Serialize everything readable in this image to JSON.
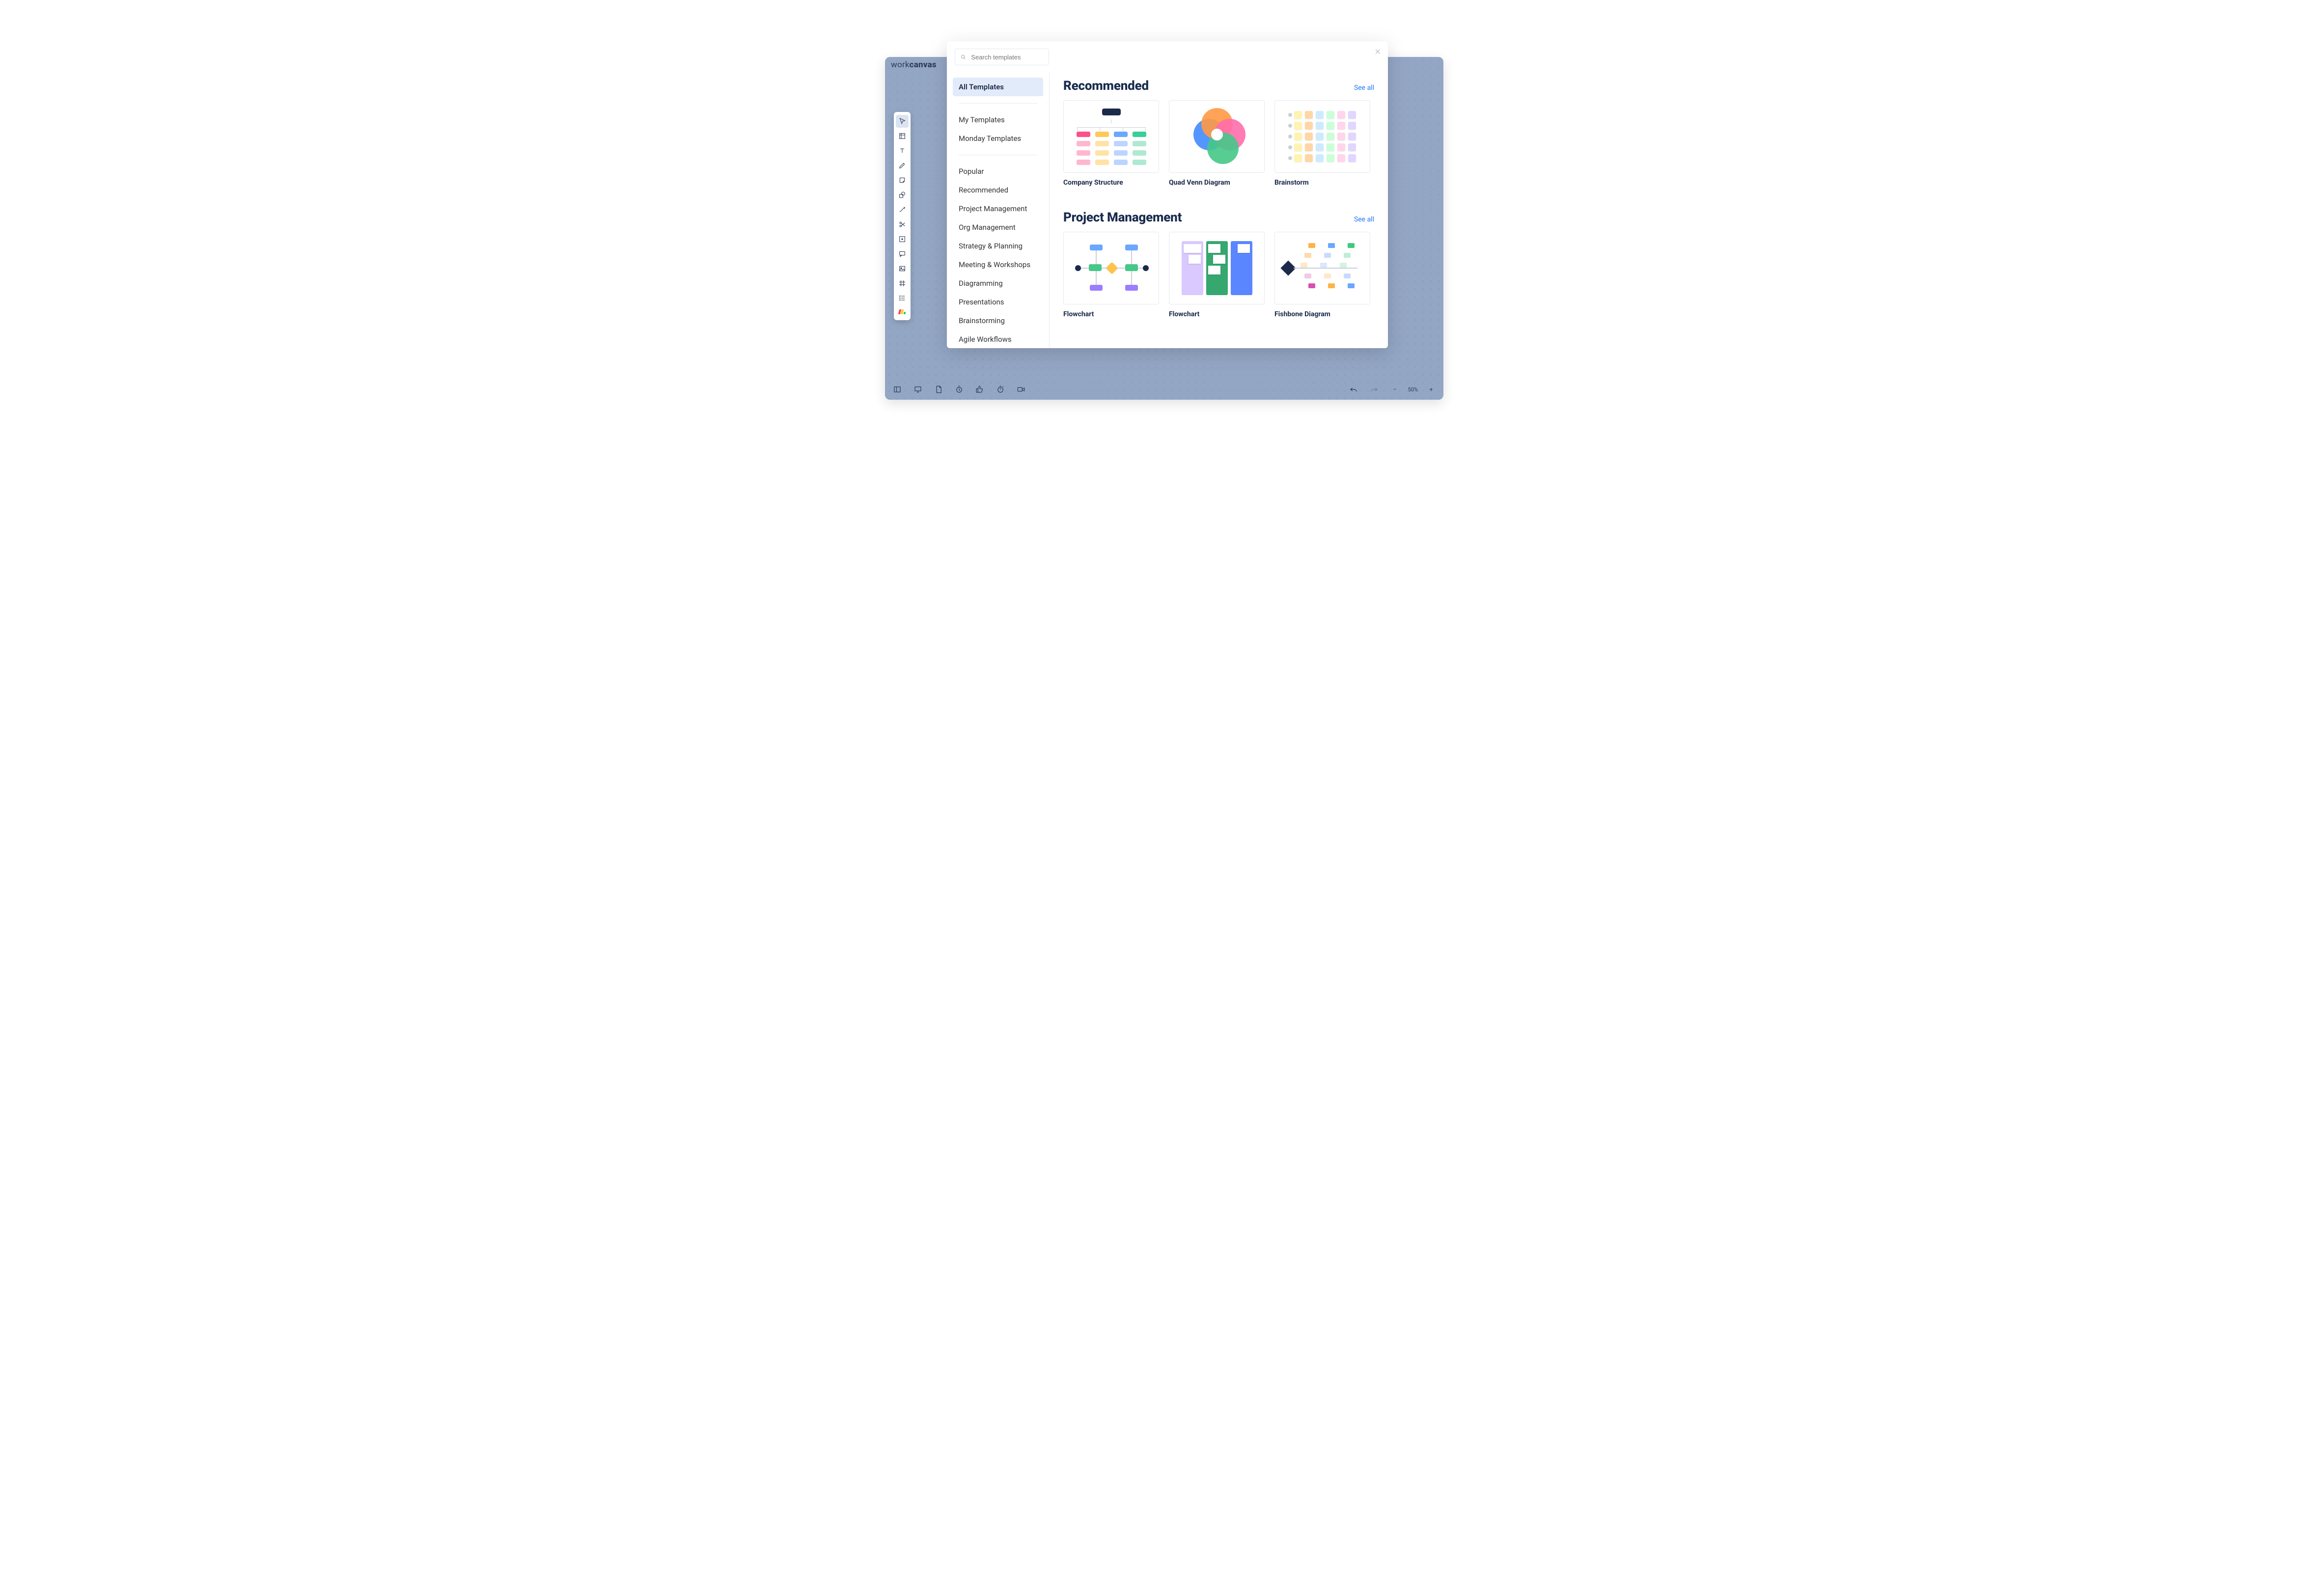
{
  "brand": {
    "thin": "work",
    "bold": "canvas"
  },
  "search": {
    "placeholder": "Search templates"
  },
  "sidebar": {
    "primary": [
      {
        "label": "All Templates",
        "selected": true
      },
      {
        "label": "My Templates"
      },
      {
        "label": "Monday Templates"
      }
    ],
    "categories": [
      {
        "label": "Popular"
      },
      {
        "label": "Recommended"
      },
      {
        "label": "Project Management"
      },
      {
        "label": "Org Management"
      },
      {
        "label": "Strategy & Planning"
      },
      {
        "label": "Meeting & Workshops"
      },
      {
        "label": "Diagramming"
      },
      {
        "label": "Presentations"
      },
      {
        "label": "Brainstorming"
      },
      {
        "label": "Agile Workflows"
      }
    ]
  },
  "sections": {
    "recommended": {
      "title": "Recommended",
      "see_all": "See all",
      "cards": [
        {
          "label": "Company Structure"
        },
        {
          "label": "Quad Venn Diagram"
        },
        {
          "label": "Brainstorm"
        }
      ]
    },
    "project_management": {
      "title": "Project Management",
      "see_all": "See all",
      "cards": [
        {
          "label": "Flowchart"
        },
        {
          "label": "Flowchart"
        },
        {
          "label": "Fishbone Diagram"
        }
      ]
    }
  },
  "zoom": {
    "level": "50%"
  }
}
